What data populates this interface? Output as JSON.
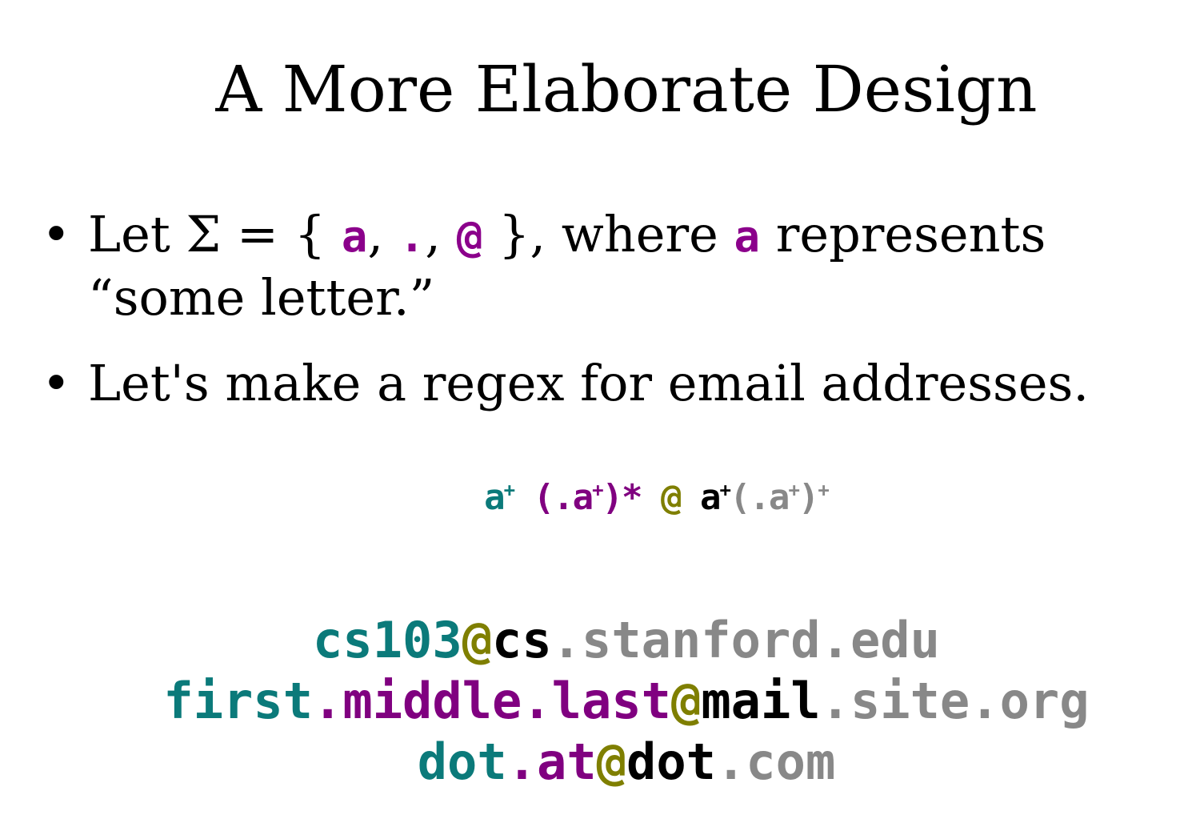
{
  "title": "A More Elaborate Design",
  "bullets": {
    "b1": {
      "dot": "•",
      "text_before": "Let Σ = { ",
      "sym_a": "a",
      "comma1": ", ",
      "sym_dot": ".",
      "comma2": ", ",
      "sym_at": "@",
      "text_mid": " }, where ",
      "sym_a2": "a",
      "text_after": " represents",
      "line2": "“some letter.”"
    },
    "b2": {
      "dot": "•",
      "text": "Let's make a regex for email addresses."
    }
  },
  "regex": {
    "part1": "a",
    "part1_sup": "+",
    "part2_open": " (.a",
    "part2_sup": "+",
    "part2_close": ")* ",
    "at": "@",
    "part3": " a",
    "part3_sup": "+",
    "part4_open": "(.a",
    "part4_sup": "+",
    "part4_close": ")",
    "part4_outer_sup": "+"
  },
  "emails": [
    {
      "local_first": "cs103",
      "local_rest": "",
      "at": "@",
      "domain": "cs",
      "tld": ".stanford.edu"
    },
    {
      "local_first": "first",
      "local_rest": ".middle.last",
      "at": "@",
      "domain": "mail",
      "tld": ".site.org"
    },
    {
      "local_first": "dot",
      "local_rest": ".at",
      "at": "@",
      "domain": "dot",
      "tld": ".com"
    }
  ],
  "colors": {
    "teal": "#0b7a7a",
    "purple": "#800080",
    "olive": "#7f7f00",
    "black": "#000000",
    "gray": "#888888",
    "symbol_magenta": "#8b008b"
  }
}
